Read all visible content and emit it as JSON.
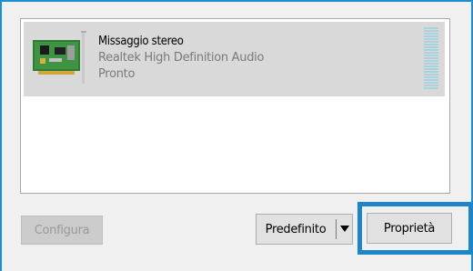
{
  "device": {
    "name": "Missaggio stereo",
    "description": "Realtek High Definition Audio",
    "status": "Pronto",
    "icon": "sound-card-icon",
    "level_percent": 0
  },
  "buttons": {
    "configure": "Configura",
    "default": "Predefinito",
    "properties": "Proprietà"
  },
  "colors": {
    "accent": "#1e86c8",
    "selection": "#d9d9d9",
    "meter": "#a6d3dc"
  }
}
